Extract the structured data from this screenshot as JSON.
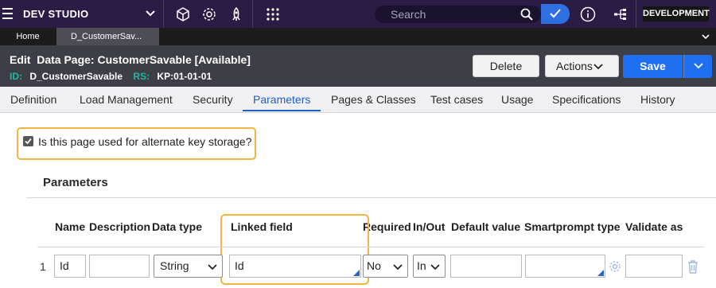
{
  "topbar": {
    "studio": "DEV STUDIO",
    "search_placeholder": "Search",
    "environment": "DEVELOPMENT",
    "icons": [
      "menu-icon",
      "chevron-down-icon",
      "cube-icon",
      "gear-icon",
      "rocket-icon",
      "app-grid-icon",
      "search-icon",
      "check-icon",
      "info-icon",
      "sitemap-icon"
    ]
  },
  "doc_tabs": {
    "home": "Home",
    "active": "D_CustomerSav...",
    "icons": [
      "chevron-down-icon"
    ]
  },
  "rule": {
    "title": "Edit  Data Page: CustomerSavable [Available]",
    "id_label": "ID:",
    "id_value": "D_CustomerSavable",
    "rs_label": "RS:",
    "rs_value": "KP:01-01-01",
    "delete": "Delete",
    "actions": "Actions",
    "save": "Save"
  },
  "tabs": [
    "Definition",
    "Load Management",
    "Security",
    "Parameters",
    "Pages & Classes",
    "Test cases",
    "Usage",
    "Specifications",
    "History"
  ],
  "active_tab": "Parameters",
  "alt_key": {
    "label": "Is this page used for alternate key storage?",
    "checked": true
  },
  "params": {
    "title": "Parameters",
    "columns": [
      "Name",
      "Description",
      "Data type",
      "Linked field",
      "Required",
      "In/Out",
      "Default value",
      "Smartprompt type",
      "Validate as"
    ],
    "rows": [
      {
        "num": "1",
        "name": "Id",
        "description": "",
        "data_type": "String",
        "linked_field": "Id",
        "required": "No",
        "in_out": "In",
        "default_value": "",
        "smartprompt": "",
        "validate_as": ""
      }
    ]
  },
  "colors": {
    "topbar": "#2b1c45",
    "header": "#3e3e47",
    "accent": "#1f6ff0",
    "highlight": "#f0b542",
    "meta_key": "#1fb8a0"
  }
}
